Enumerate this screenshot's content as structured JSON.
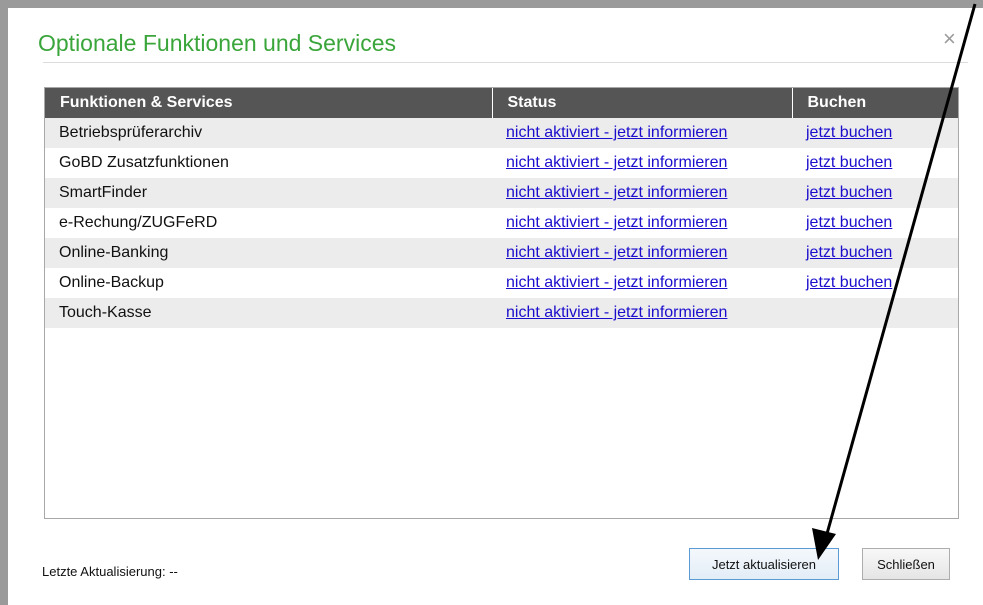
{
  "dialog": {
    "title": "Optionale Funktionen und Services",
    "close_glyph": "×"
  },
  "table": {
    "headers": [
      "Funktionen & Services",
      "Status",
      "Buchen"
    ],
    "rows": [
      {
        "name": "Betriebsprüferarchiv",
        "status": "nicht aktiviert - jetzt informieren",
        "book": "jetzt buchen"
      },
      {
        "name": "GoBD Zusatzfunktionen",
        "status": "nicht aktiviert - jetzt informieren",
        "book": "jetzt buchen"
      },
      {
        "name": "SmartFinder",
        "status": "nicht aktiviert - jetzt informieren",
        "book": "jetzt buchen"
      },
      {
        "name": "e-Rechung/ZUGFeRD",
        "status": "nicht aktiviert - jetzt informieren",
        "book": "jetzt buchen"
      },
      {
        "name": "Online-Banking",
        "status": "nicht aktiviert - jetzt informieren",
        "book": "jetzt buchen"
      },
      {
        "name": "Online-Backup",
        "status": "nicht aktiviert - jetzt informieren",
        "book": "jetzt buchen"
      },
      {
        "name": "Touch-Kasse",
        "status": "nicht aktiviert - jetzt informieren",
        "book": ""
      }
    ]
  },
  "footer": {
    "last_update": "Letzte Aktualisierung: --",
    "update_button": "Jetzt aktualisieren",
    "close_button": "Schließen"
  },
  "colors": {
    "title": "#3aa53a",
    "header_bg": "#555555",
    "link": "#1a0dcc"
  }
}
